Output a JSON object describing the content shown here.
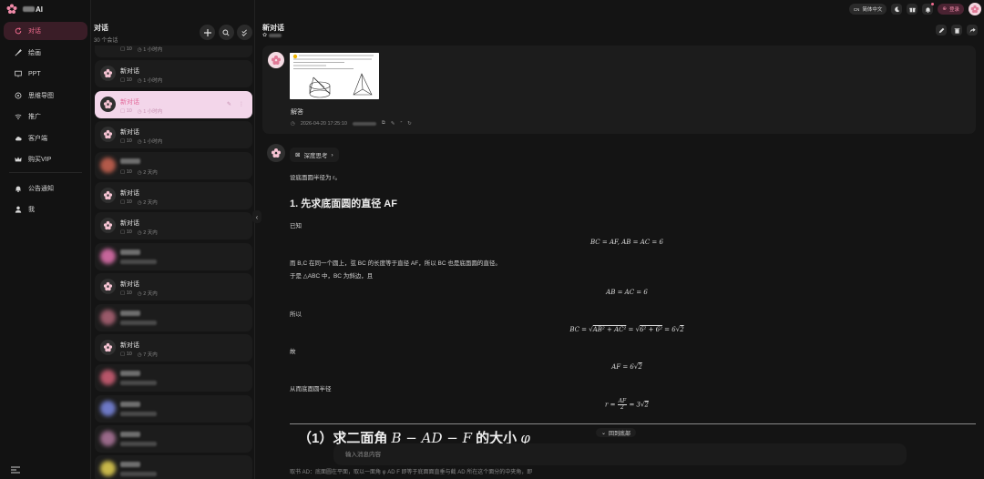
{
  "brand": {
    "name": "AI",
    "accent": "#f08aa8"
  },
  "nav": {
    "items": [
      {
        "label": "对话",
        "icon": "chat-refresh-icon",
        "active": true
      },
      {
        "label": "绘画",
        "icon": "brush-icon"
      },
      {
        "label": "PPT",
        "icon": "slides-icon"
      },
      {
        "label": "思维导图",
        "icon": "mindmap-icon"
      },
      {
        "label": "推广",
        "icon": "share-icon"
      },
      {
        "label": "客户端",
        "icon": "cloud-icon"
      },
      {
        "label": "购买VIP",
        "icon": "crown-icon"
      }
    ],
    "items2": [
      {
        "label": "公告通知",
        "icon": "bell-icon"
      },
      {
        "label": "我",
        "icon": "user-icon"
      }
    ]
  },
  "conversations": {
    "title": "对话",
    "count_text": "30 个会话",
    "first_meta": {
      "msgs": "10",
      "time": "1 小时内"
    },
    "items": [
      {
        "title": "新对话",
        "msgs": "10",
        "time": "1 小时内",
        "blurred": false
      },
      {
        "title": "新对话",
        "msgs": "10",
        "time": "1 小时内",
        "blurred": false,
        "active": true
      },
      {
        "title": "新对话",
        "msgs": "10",
        "time": "1 小时内",
        "blurred": false
      },
      {
        "title": "",
        "msgs": "10",
        "time": "2 天内",
        "blurred": true
      },
      {
        "title": "新对话",
        "msgs": "10",
        "time": "2 天内",
        "blurred": false
      },
      {
        "title": "新对话",
        "msgs": "10",
        "time": "2 天内",
        "blurred": false
      },
      {
        "title": "",
        "msgs": "",
        "time": "",
        "blurred": true
      },
      {
        "title": "新对话",
        "msgs": "10",
        "time": "2 天内",
        "blurred": false
      },
      {
        "title": "",
        "msgs": "",
        "time": "",
        "blurred": true
      },
      {
        "title": "新对话",
        "msgs": "10",
        "time": "7 天内",
        "blurred": false
      },
      {
        "title": "",
        "msgs": "",
        "time": "",
        "blurred": true
      },
      {
        "title": "",
        "msgs": "",
        "time": "",
        "blurred": true
      },
      {
        "title": "",
        "msgs": "",
        "time": "",
        "blurred": true
      },
      {
        "title": "",
        "msgs": "",
        "time": "",
        "blurred": true
      }
    ]
  },
  "topbar": {
    "lang": "简体中文",
    "lang_prefix": "CN",
    "upgrade": "登录"
  },
  "chat": {
    "title": "新对话",
    "user_msg": {
      "text": "解答",
      "time": "2026-04-20 17:25:10"
    },
    "thinking_label": "深度思考",
    "content": {
      "intro": "设底面圆半径为 r。",
      "h1": "1. 先求底面圆的直径 AF",
      "known": "已知",
      "f1": "BC = AF,    AB = AC = 6",
      "p2": "而 B,C 在同一个圆上，弦 BC 的长度等于直径 AF，所以 BC 也是底面圆的直径。",
      "p3": "于是 △ABC 中，BC 为斜边，且",
      "f2": "AB = AC = 6",
      "so": "所以",
      "f3a": "BC = ",
      "f3b": "AB² + AC²",
      "f3c": " = ",
      "f3d": "6² + 6²",
      "f3e": " = 6",
      "f3f": "2",
      "gu": "故",
      "f4a": "AF = 6",
      "f4b": "2",
      "radius": "从而底面圆半径",
      "f5a": "r = ",
      "f5n": "AF",
      "f5d": "2",
      "f5e": " = 3",
      "f5f": "2"
    },
    "big_heading": {
      "pre": "（1）求二面角 ",
      "math": "B − AD − F",
      "post": " 的大小 ",
      "tail": "φ"
    },
    "back_bottom": "回到底部",
    "input_placeholder": "输入消息内容",
    "cut_text": "取书 AD：底面圆在平面，取以一面角 φ    AD    F 即等于底面面直垂与截 AD 所在这个面分的中夹角，即"
  }
}
